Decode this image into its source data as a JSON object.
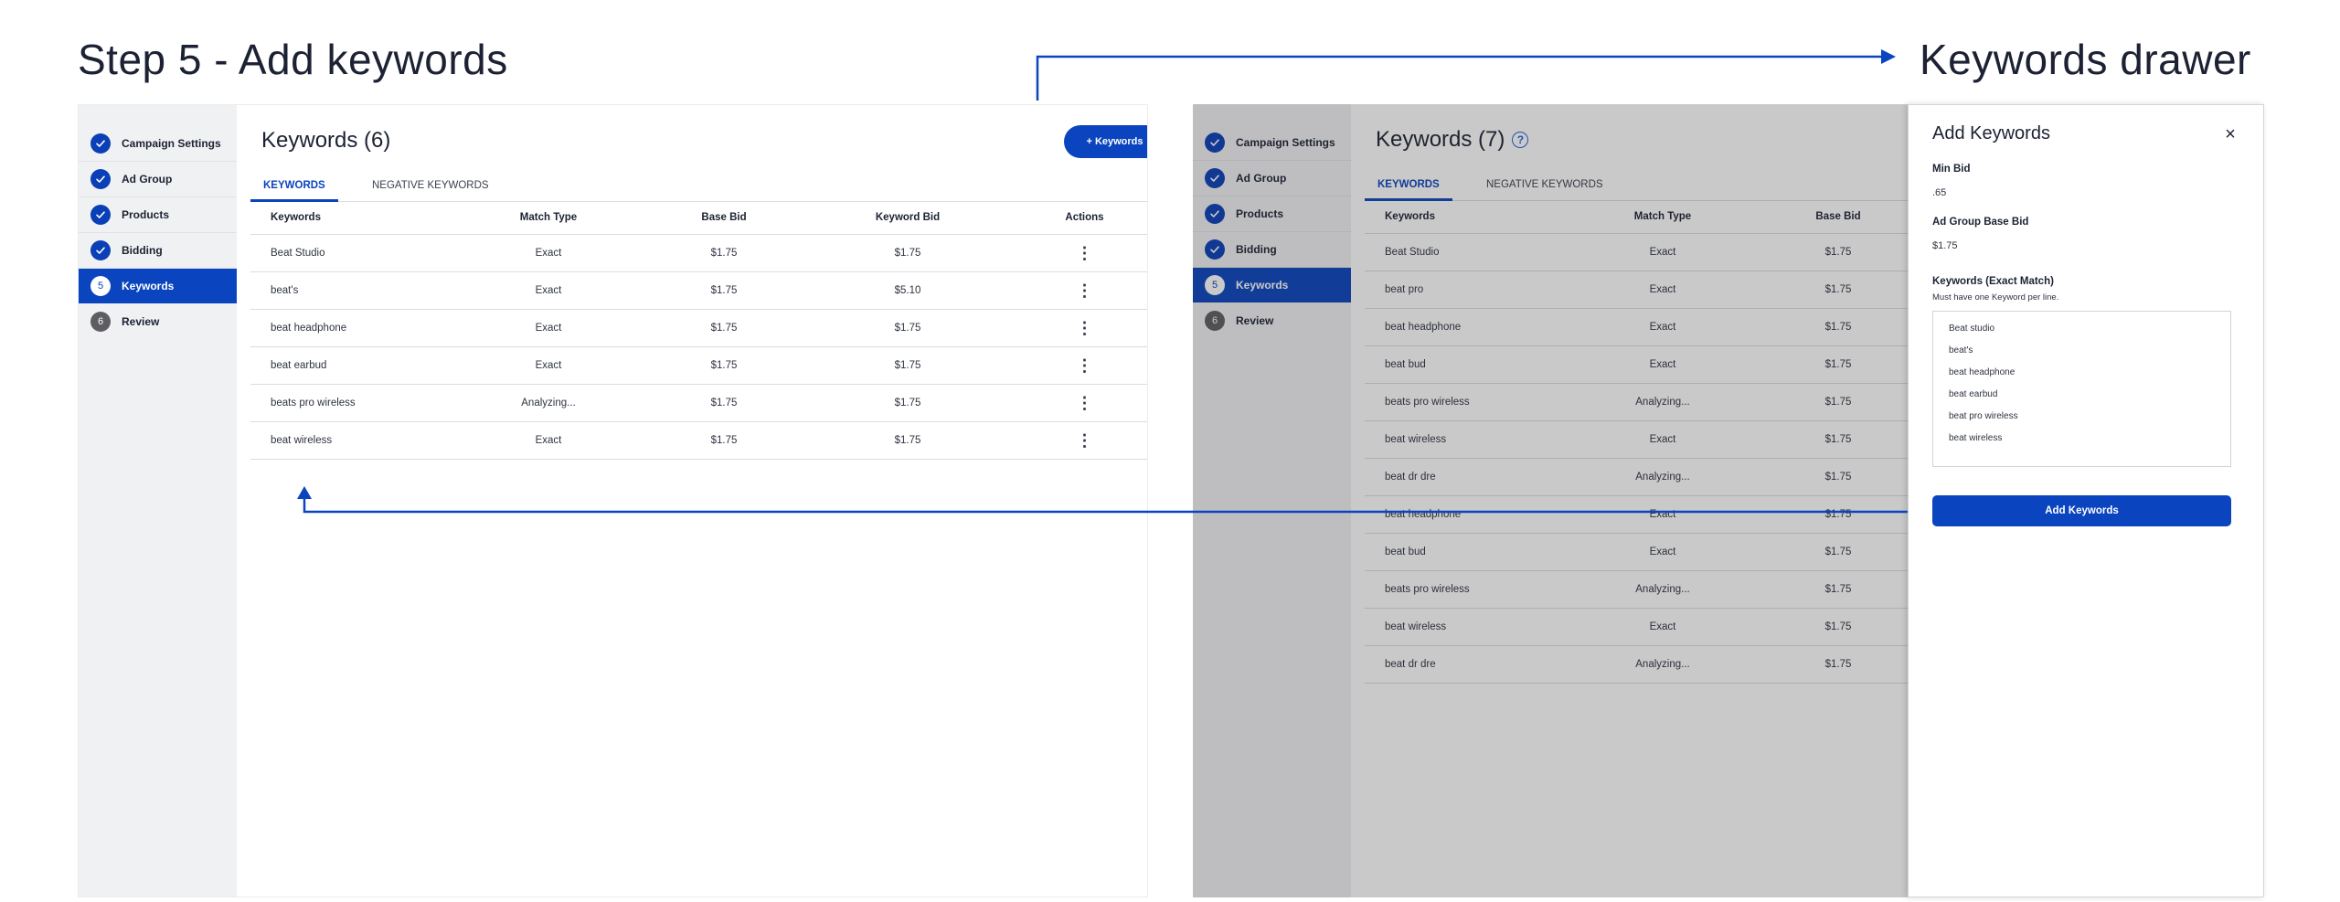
{
  "headings": {
    "left": "Step 5 - Add keywords",
    "right": "Keywords drawer"
  },
  "steps": [
    {
      "label": "Campaign Settings",
      "state": "done"
    },
    {
      "label": "Ad Group",
      "state": "done"
    },
    {
      "label": "Products",
      "state": "done"
    },
    {
      "label": "Bidding",
      "state": "done"
    },
    {
      "label": "Keywords",
      "state": "active",
      "number": "5"
    },
    {
      "label": "Review",
      "state": "pending",
      "number": "6"
    }
  ],
  "left_panel": {
    "title": "Keywords (6)",
    "add_button": "+ Keywords",
    "tabs": [
      "KEYWORDS",
      "NEGATIVE KEYWORDS"
    ],
    "columns": [
      "Keywords",
      "Match Type",
      "Base Bid",
      "Keyword Bid",
      "Actions"
    ],
    "rows": [
      {
        "keyword": "Beat Studio",
        "match": "Exact",
        "base": "$1.75",
        "bid": "$1.75"
      },
      {
        "keyword": "beat's",
        "match": "Exact",
        "base": "$1.75",
        "bid": "$5.10"
      },
      {
        "keyword": "beat headphone",
        "match": "Exact",
        "base": "$1.75",
        "bid": "$1.75"
      },
      {
        "keyword": "beat earbud",
        "match": "Exact",
        "base": "$1.75",
        "bid": "$1.75"
      },
      {
        "keyword": "beats pro wireless",
        "match": "Analyzing...",
        "base": "$1.75",
        "bid": "$1.75"
      },
      {
        "keyword": "beat wireless",
        "match": "Exact",
        "base": "$1.75",
        "bid": "$1.75"
      }
    ],
    "kebab": "⋮"
  },
  "right_panel": {
    "title": "Keywords (7)",
    "help": "?",
    "tabs": [
      "KEYWORDS",
      "NEGATIVE KEYWORDS"
    ],
    "columns": [
      "Keywords",
      "Match Type",
      "Base Bid"
    ],
    "rows": [
      {
        "keyword": "Beat Studio",
        "match": "Exact",
        "base": "$1.75"
      },
      {
        "keyword": "beat pro",
        "match": "Exact",
        "base": "$1.75"
      },
      {
        "keyword": "beat headphone",
        "match": "Exact",
        "base": "$1.75"
      },
      {
        "keyword": "beat bud",
        "match": "Exact",
        "base": "$1.75"
      },
      {
        "keyword": "beats pro wireless",
        "match": "Analyzing...",
        "base": "$1.75"
      },
      {
        "keyword": "beat wireless",
        "match": "Exact",
        "base": "$1.75"
      },
      {
        "keyword": "beat dr dre",
        "match": "Analyzing...",
        "base": "$1.75"
      },
      {
        "keyword": "beat headphone",
        "match": "Exact",
        "base": "$1.75"
      },
      {
        "keyword": "beat bud",
        "match": "Exact",
        "base": "$1.75"
      },
      {
        "keyword": "beats pro wireless",
        "match": "Analyzing...",
        "base": "$1.75"
      },
      {
        "keyword": "beat wireless",
        "match": "Exact",
        "base": "$1.75"
      },
      {
        "keyword": "beat dr dre",
        "match": "Analyzing...",
        "base": "$1.75"
      }
    ]
  },
  "drawer": {
    "title": "Add Keywords",
    "close": "×",
    "min_bid_label": "Min Bid",
    "min_bid_value": ".65",
    "base_bid_label": "Ad Group Base Bid",
    "base_bid_value": "$1.75",
    "keywords_label": "Keywords (Exact Match)",
    "keywords_hint": "Must have one Keyword per line.",
    "keywords_lines": [
      "Beat studio",
      "beat's",
      "beat headphone",
      "beat earbud",
      "beat pro wireless",
      "beat wireless"
    ],
    "submit": "Add Keywords"
  },
  "colors": {
    "primary": "#0a44be",
    "arrow": "#0a44be",
    "sidebar_bg": "#f0f1f3"
  },
  "icons": {
    "done": "check-icon",
    "help": "help-circle-icon",
    "close": "close-icon",
    "actions": "kebab-menu-icon"
  }
}
